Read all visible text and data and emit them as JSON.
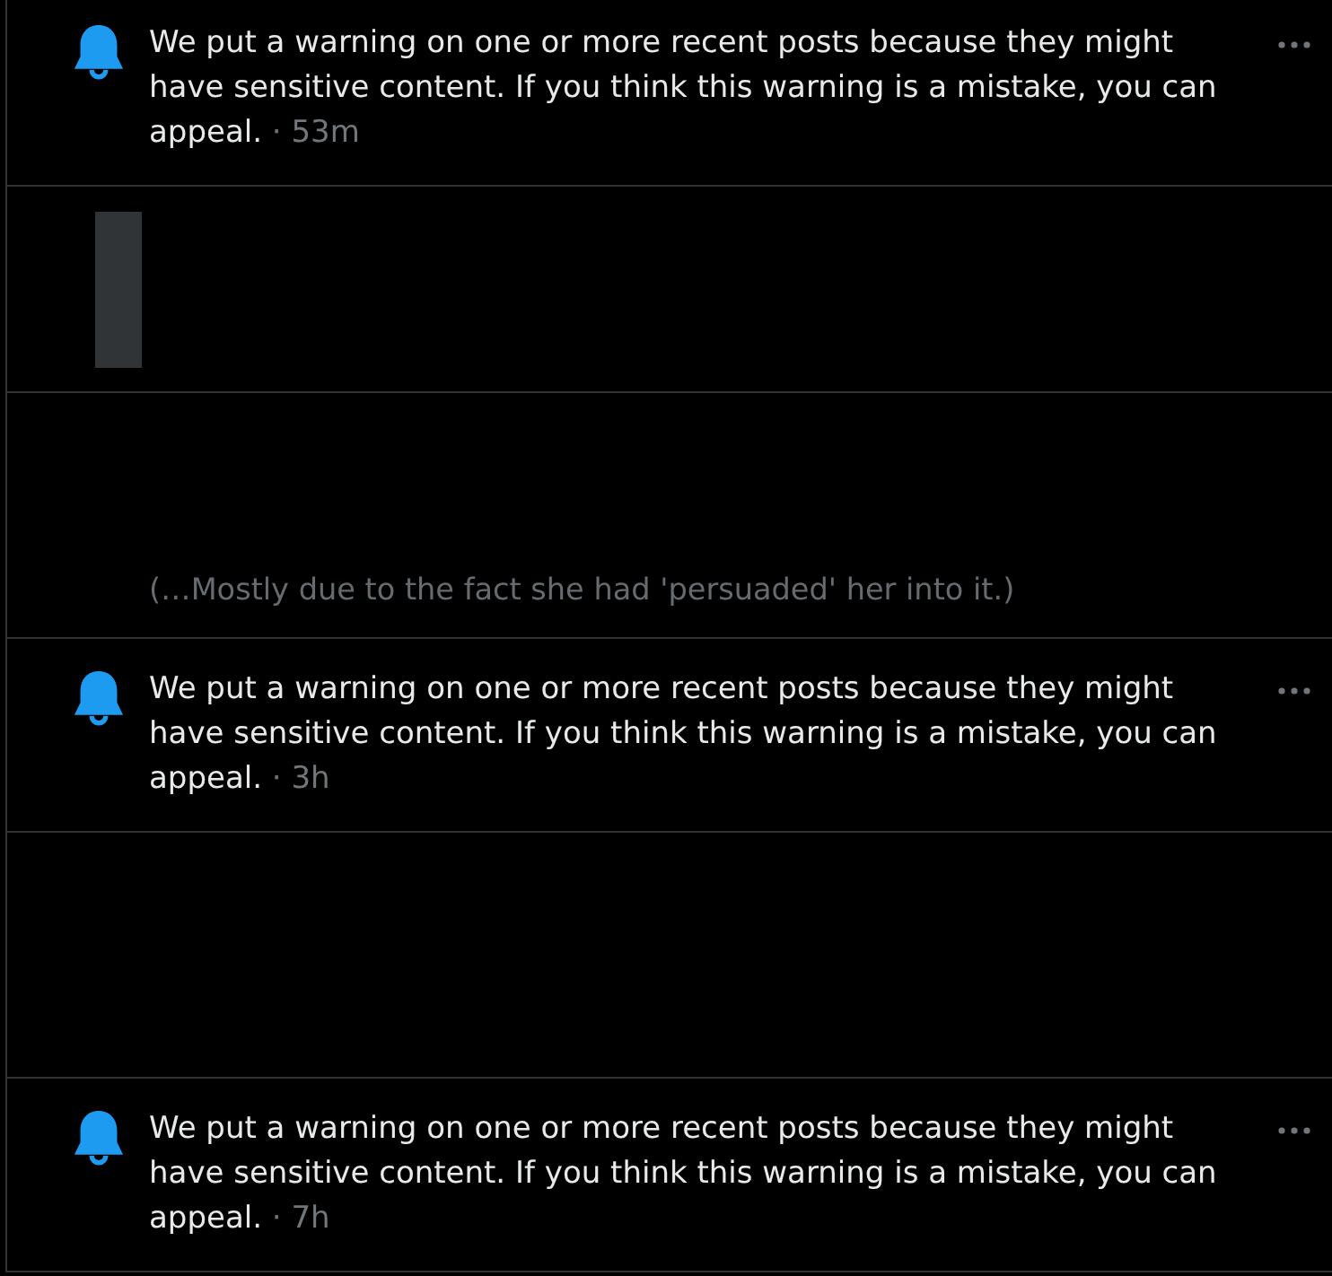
{
  "feed": [
    {
      "kind": "notice",
      "text": "We put a warning on one or more recent posts because they might have sensitive content. If you think this warning is a mistake, you can appeal.",
      "separator": "·",
      "time": "53m"
    },
    {
      "kind": "media"
    },
    {
      "kind": "snippet",
      "text": "(…Mostly due to the fact she had 'persuaded' her into it.)"
    },
    {
      "kind": "notice",
      "text": "We put a warning on one or more recent posts because they might have sensitive content. If you think this warning is a mistake, you can appeal.",
      "separator": "·",
      "time": "3h"
    },
    {
      "kind": "blank"
    },
    {
      "kind": "notice",
      "text": "We put a warning on one or more recent posts because they might have sensitive content. If you think this warning is a mistake, you can appeal.",
      "separator": "·",
      "time": "7h"
    }
  ]
}
